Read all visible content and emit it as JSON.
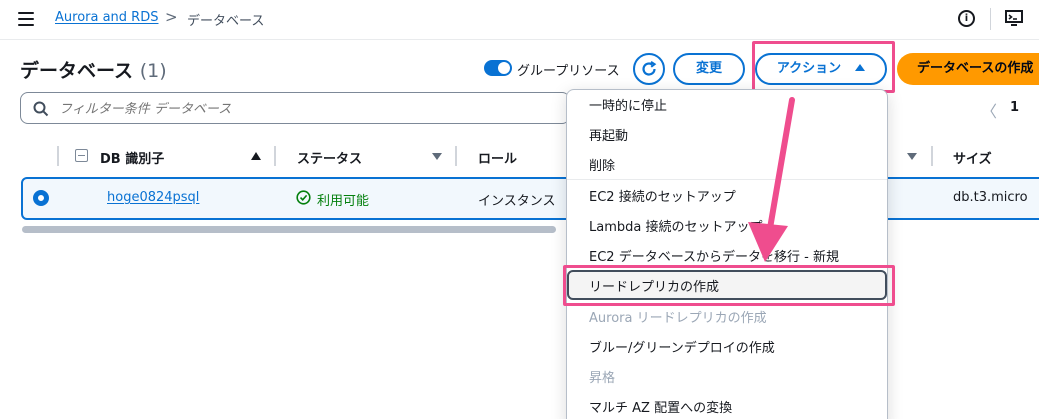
{
  "header": {
    "breadcrumb_link": "Aurora and RDS",
    "breadcrumb_sep": ">",
    "breadcrumb_current": "データベース"
  },
  "main": {
    "title": "データベース",
    "count": "(1)",
    "group_toggle_label": "グループリソース",
    "change_button": "変更",
    "action_button": "アクション",
    "create_button": "データベースの作成",
    "filter_placeholder": "フィルター条件 データベース",
    "pager_prev": "〈",
    "pager_page": "1"
  },
  "table": {
    "columns": [
      "DB 識別子",
      "ステータス",
      "ロール",
      "サイズ"
    ],
    "rows": [
      {
        "id": "hoge0824psql",
        "status": "利用可能",
        "role": "インスタンス",
        "size": "db.t3.micro"
      }
    ]
  },
  "menu": {
    "items": [
      {
        "label": "一時的に停止"
      },
      {
        "label": "再起動"
      },
      {
        "label": "削除"
      },
      {
        "label": "EC2 接続のセットアップ"
      },
      {
        "label": "Lambda 接続のセットアップ"
      },
      {
        "label": "EC2 データベースからデータを移行 - 新規"
      },
      {
        "label": "リードレプリカの作成"
      },
      {
        "label": "Aurora リードレプリカの作成"
      },
      {
        "label": "ブルー/グリーンデプロイの作成"
      },
      {
        "label": "昇格"
      },
      {
        "label": "マルチ AZ 配置への変換"
      }
    ]
  },
  "colors": {
    "accent": "#0972d3",
    "primary_button": "#ff9900",
    "annotation": "#ef4d8e",
    "status_ok": "#037f0c"
  }
}
